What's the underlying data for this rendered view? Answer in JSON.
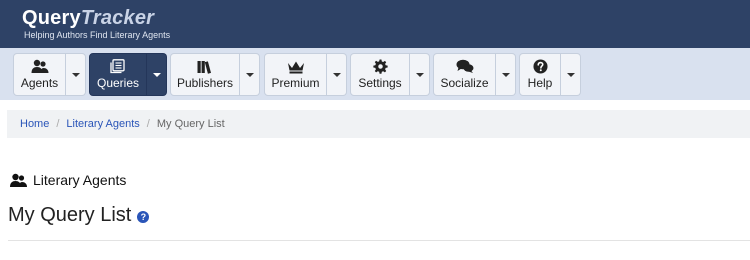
{
  "brand": {
    "query": "Query",
    "tracker": "Tracker",
    "tagline": "Helping Authors Find Literary Agents"
  },
  "nav": [
    {
      "label": "Agents",
      "icon": "users-icon"
    },
    {
      "label": "Queries",
      "icon": "papers-icon",
      "active": true
    },
    {
      "label": "Publishers",
      "icon": "books-icon"
    },
    {
      "label": "Premium",
      "icon": "crown-icon"
    },
    {
      "label": "Settings",
      "icon": "gear-icon"
    },
    {
      "label": "Socialize",
      "icon": "chat-icon"
    },
    {
      "label": "Help",
      "icon": "question-icon"
    }
  ],
  "breadcrumb": {
    "home": "Home",
    "agents": "Literary Agents",
    "current": "My Query List"
  },
  "section": {
    "label": "Literary Agents"
  },
  "page": {
    "title": "My Query List",
    "help_glyph": "?"
  },
  "colors": {
    "header": "#2e4266",
    "navbar": "#d9e1ef",
    "link": "#2a55b8"
  }
}
